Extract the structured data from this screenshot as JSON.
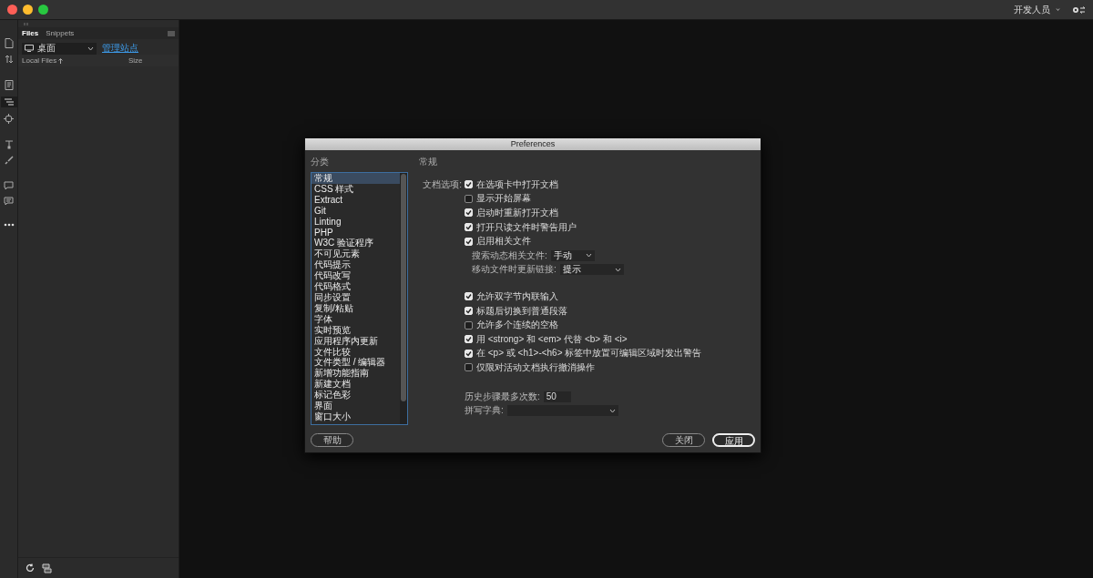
{
  "title_bar": {
    "workspace": "开发人员"
  },
  "files_panel": {
    "tabs": [
      {
        "label": "Files",
        "selected": true
      },
      {
        "label": "Snippets",
        "selected": false
      }
    ],
    "location": "桌面",
    "manage_link": "管理站点",
    "columns": [
      "Local Files",
      "Size"
    ]
  },
  "dialog": {
    "title": "Preferences",
    "category_heading": "分类",
    "section_heading": "常规",
    "categories": [
      {
        "label": "常规",
        "selected": true
      },
      {
        "label": "CSS 样式",
        "selected": false
      },
      {
        "label": "Extract",
        "selected": false
      },
      {
        "label": "Git",
        "selected": false
      },
      {
        "label": "Linting",
        "selected": false
      },
      {
        "label": "PHP",
        "selected": false
      },
      {
        "label": "W3C 验证程序",
        "selected": false
      },
      {
        "label": "不可见元素",
        "selected": false
      },
      {
        "label": "代码提示",
        "selected": false
      },
      {
        "label": "代码改写",
        "selected": false
      },
      {
        "label": "代码格式",
        "selected": false
      },
      {
        "label": "同步设置",
        "selected": false
      },
      {
        "label": "复制/粘贴",
        "selected": false
      },
      {
        "label": "字体",
        "selected": false
      },
      {
        "label": "实时预览",
        "selected": false
      },
      {
        "label": "应用程序内更新",
        "selected": false
      },
      {
        "label": "文件比较",
        "selected": false
      },
      {
        "label": "文件类型 / 编辑器",
        "selected": false
      },
      {
        "label": "新增功能指南",
        "selected": false
      },
      {
        "label": "新建文档",
        "selected": false
      },
      {
        "label": "标记色彩",
        "selected": false
      },
      {
        "label": "界面",
        "selected": false
      },
      {
        "label": "窗口大小",
        "selected": false
      }
    ],
    "options": [
      {
        "kind": "checkbox",
        "group_label": "文档选项:",
        "label": "在选项卡中打开文档",
        "checked": true
      },
      {
        "kind": "checkbox",
        "label": "显示开始屏幕",
        "checked": false
      },
      {
        "kind": "checkbox",
        "label": "启动时重新打开文档",
        "checked": true
      },
      {
        "kind": "checkbox",
        "label": "打开只读文件时警告用户",
        "checked": true
      },
      {
        "kind": "checkbox",
        "label": "启用相关文件",
        "checked": true
      },
      {
        "kind": "select",
        "label": "搜索动态相关文件:",
        "value": "手动"
      },
      {
        "kind": "select",
        "label": "移动文件时更新链接:",
        "value": "提示"
      },
      {
        "kind": "checkbox",
        "label": "允许双字节内联输入",
        "checked": true
      },
      {
        "kind": "checkbox",
        "label": "标题后切换到普通段落",
        "checked": true
      },
      {
        "kind": "checkbox",
        "label": "允许多个连续的空格",
        "checked": false
      },
      {
        "kind": "checkbox",
        "label": "用 <strong> 和 <em> 代替 <b> 和 <i>",
        "checked": true
      },
      {
        "kind": "checkbox",
        "label": "在 <p> 或 <h1>-<h6> 标签中放置可编辑区域时发出警告",
        "checked": true
      },
      {
        "kind": "checkbox",
        "label": "仅限对活动文档执行撤消操作",
        "checked": false
      },
      {
        "kind": "input",
        "label": "历史步骤最多次数:",
        "value": "50"
      },
      {
        "kind": "dropdown",
        "label": "拼写字典:"
      }
    ],
    "buttons": [
      {
        "label": "帮助",
        "primary": false
      },
      {
        "label": "关闭",
        "primary": false
      },
      {
        "label": "应用",
        "primary": true
      }
    ]
  }
}
